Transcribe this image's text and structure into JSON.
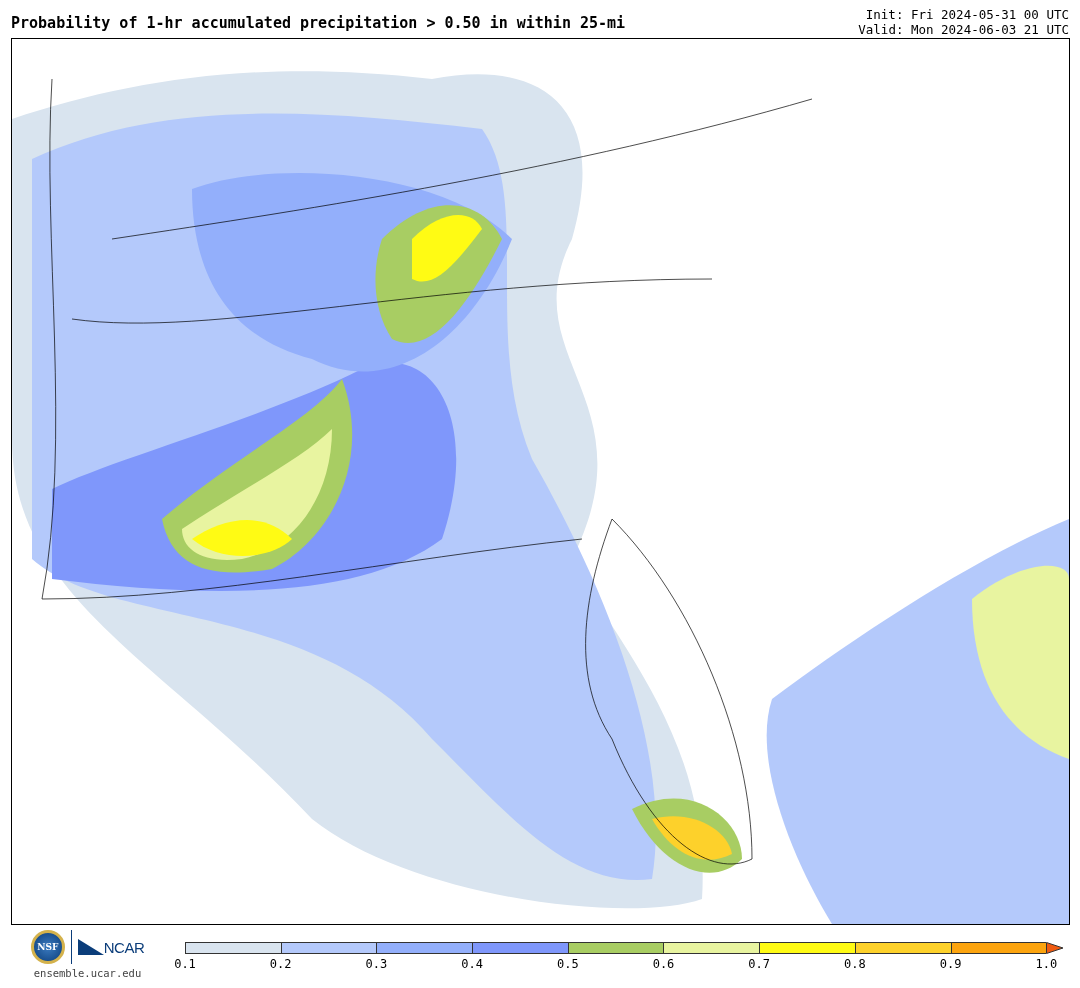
{
  "title": "Probability of 1-hr accumulated precipitation > 0.50 in within 25-mi",
  "init": "Init: Fri 2024-05-31 00 UTC",
  "valid": "Valid: Mon 2024-06-03 21 UTC",
  "logos": {
    "nsf": "NSF",
    "ncar": "NCAR",
    "site": "ensemble.ucar.edu"
  },
  "colorbar": {
    "bins": [
      {
        "color": "#d9e4ef"
      },
      {
        "color": "#b4c9fb"
      },
      {
        "color": "#93affb"
      },
      {
        "color": "#7f97fb"
      },
      {
        "color": "#a8cd63"
      },
      {
        "color": "#e8f4a0"
      },
      {
        "color": "#fffb14"
      },
      {
        "color": "#fdd12b"
      },
      {
        "color": "#fca40e"
      }
    ],
    "extend": {
      "color": "#f05a10"
    },
    "ticks": [
      "0.1",
      "0.2",
      "0.3",
      "0.4",
      "0.5",
      "0.6",
      "0.7",
      "0.8",
      "0.9",
      "1.0"
    ]
  }
}
